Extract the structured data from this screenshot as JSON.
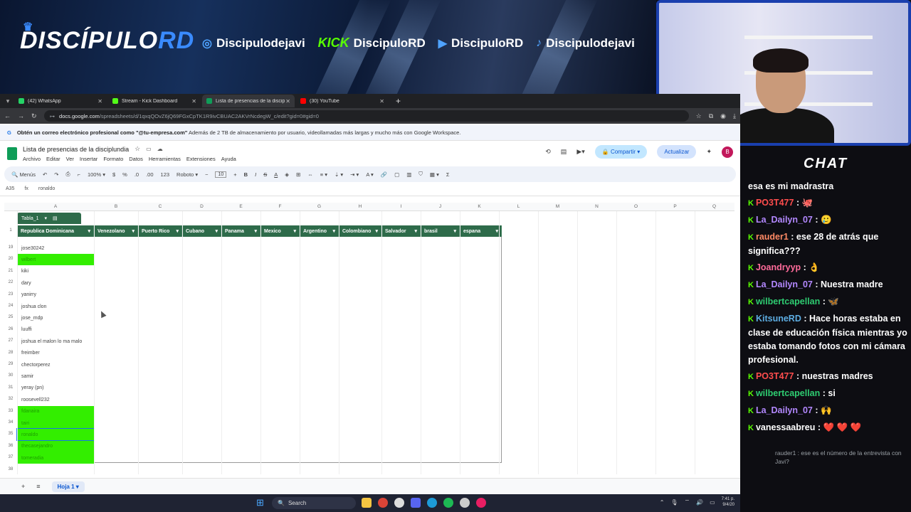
{
  "stream": {
    "logo_main": "DISCÍPULO",
    "logo_accent": "RD",
    "socials": [
      {
        "icon": "instagram-icon",
        "label": "Discipulodejavi"
      },
      {
        "icon": "kick-icon",
        "brand": "KICK",
        "label": "DiscipuloRD"
      },
      {
        "icon": "youtube-icon",
        "label": "DiscipuloRD"
      },
      {
        "icon": "tiktok-icon",
        "label": "Discipulodejavi"
      }
    ]
  },
  "browser": {
    "tabs": [
      {
        "label": "(42) WhatsApp",
        "color": "#25d366"
      },
      {
        "label": "Stream - Kick Dashboard",
        "color": "#53fc18"
      },
      {
        "label": "Lista de presencias de la discip",
        "color": "#0f9d58"
      },
      {
        "label": "(30) YouTube",
        "color": "#ff0000"
      }
    ],
    "url_host": "docs.google.com",
    "url_path": "/spreadsheets/d/1qxqQOvZ6jQ69FGxCpTK1R9ivCBUAC2AKVrNcdegW_c/edit?gid=0#gid=0"
  },
  "promo": {
    "text_bold": "Obtén un correo electrónico profesional como \"@tu-empresa.com\"",
    "text_rest": "Además de 2 TB de almacenamiento por usuario, videollamadas más largas y mucho más con Google Workspace."
  },
  "doc": {
    "title": "Lista de presencias de la disciplundia",
    "menus": [
      "Archivo",
      "Editar",
      "Ver",
      "Insertar",
      "Formato",
      "Datos",
      "Herramientas",
      "Extensiones",
      "Ayuda"
    ],
    "share_label": "Compartir",
    "update_label": "Actualizar",
    "avatar_letter": "B"
  },
  "toolbar": {
    "menus_label": "Menús",
    "zoom": "100%",
    "currency": "$",
    "percent": "%",
    "dec_less": ".0",
    "dec_more": ".00",
    "numfmt": "123",
    "font": "Roboto",
    "font_size": "10"
  },
  "formula": {
    "cell_ref": "A35",
    "value": "ronaldo"
  },
  "sheet": {
    "columns": [
      "A",
      "B",
      "C",
      "D",
      "E",
      "F",
      "G",
      "H",
      "I",
      "J",
      "K",
      "L",
      "M",
      "N",
      "O",
      "P",
      "Q"
    ],
    "table_name": "Tabla_1",
    "headers": [
      "Republica Dominicana",
      "Venezolano",
      "Puerto Rico",
      "Cubano",
      "Panama",
      "Mexico",
      "Argentino",
      "Colombiano",
      "Salvador",
      "brasil",
      "espana"
    ],
    "header_row": "1",
    "rows": [
      {
        "n": "19",
        "v": "jose30242",
        "green": false
      },
      {
        "n": "20",
        "v": "wilbert",
        "green": true
      },
      {
        "n": "21",
        "v": "kiki",
        "green": false
      },
      {
        "n": "22",
        "v": "dary",
        "green": false
      },
      {
        "n": "23",
        "v": "yanirry",
        "green": false
      },
      {
        "n": "24",
        "v": "joshua clon",
        "green": false
      },
      {
        "n": "25",
        "v": "jose_mdp",
        "green": false
      },
      {
        "n": "26",
        "v": "luuffi",
        "green": false
      },
      {
        "n": "27",
        "v": "joshua el malon lo ma malo",
        "green": false
      },
      {
        "n": "28",
        "v": "freimber",
        "green": false
      },
      {
        "n": "29",
        "v": "chectorperez",
        "green": false
      },
      {
        "n": "30",
        "v": "samir",
        "green": false
      },
      {
        "n": "31",
        "v": "yeray (pn)",
        "green": false
      },
      {
        "n": "32",
        "v": "roosevell232",
        "green": false
      },
      {
        "n": "33",
        "v": "fdanaira",
        "green": true
      },
      {
        "n": "34",
        "v": "tairi",
        "green": true
      },
      {
        "n": "35",
        "v": "ronaldo",
        "green": true
      },
      {
        "n": "36",
        "v": "thecasejandro",
        "green": true
      },
      {
        "n": "37",
        "v": "tomeradia",
        "green": true
      },
      {
        "n": "38",
        "v": "",
        "green": false
      }
    ],
    "sheet_tab": "Hoja 1"
  },
  "chat": {
    "title": "CHAT",
    "messages": [
      {
        "user": "",
        "user_color": "#ffffff",
        "text": "esa es mi madrastra"
      },
      {
        "user": "PO3T477",
        "user_color": "#ff4d4d",
        "text": ":",
        "emote": "🐙"
      },
      {
        "user": "La_Dailyn_07",
        "user_color": "#b388ff",
        "text": ":",
        "emote": "🥲"
      },
      {
        "user": "rauder1",
        "user_color": "#ff8a65",
        "text": ": ese 28 de atrás que significa???"
      },
      {
        "user": "Joandryyp",
        "user_color": "#ff6b9a",
        "text": ":",
        "emote": "👌"
      },
      {
        "user": "La_Dailyn_07",
        "user_color": "#b388ff",
        "text": ": Nuestra madre"
      },
      {
        "user": "wilbertcapellan",
        "user_color": "#2ecc71",
        "text": ":",
        "emote": "🦋"
      },
      {
        "user": "KitsuneRD",
        "user_color": "#5dade2",
        "text": ": Hace horas estaba en clase de educación física mientras yo estaba tomando fotos con mi cámara profesional."
      },
      {
        "user": "PO3T477",
        "user_color": "#ff4d4d",
        "text": ": nuestras madres"
      },
      {
        "user": "wilbertcapellan",
        "user_color": "#2ecc71",
        "text": ": si"
      },
      {
        "user": "La_Dailyn_07",
        "user_color": "#b388ff",
        "text": ":",
        "emote": "🙌"
      },
      {
        "user": "vanessaabreu",
        "user_color": "#ffffff",
        "text": ":",
        "emote": "❤️ ❤️ ❤️"
      }
    ],
    "pending": "rauder1 : ese es el número de la entrevista con Javi?"
  },
  "taskbar": {
    "search_label": "Search",
    "time": "7:41 p.",
    "date": "9/4/20"
  }
}
